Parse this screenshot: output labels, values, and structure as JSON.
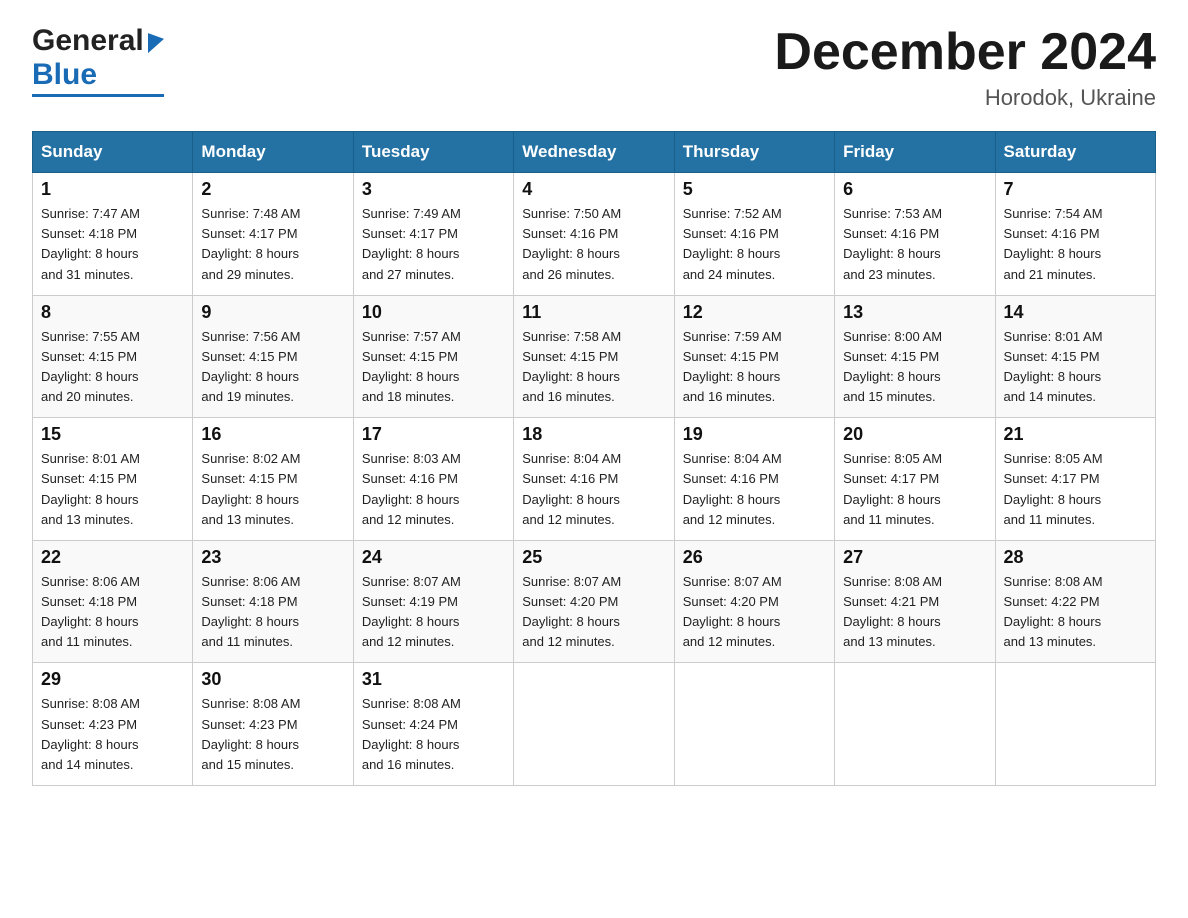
{
  "header": {
    "logo_general": "General",
    "logo_blue": "Blue",
    "month_title": "December 2024",
    "location": "Horodok, Ukraine"
  },
  "days_of_week": [
    "Sunday",
    "Monday",
    "Tuesday",
    "Wednesday",
    "Thursday",
    "Friday",
    "Saturday"
  ],
  "weeks": [
    [
      {
        "day": "1",
        "sunrise": "7:47 AM",
        "sunset": "4:18 PM",
        "daylight": "8 hours and 31 minutes."
      },
      {
        "day": "2",
        "sunrise": "7:48 AM",
        "sunset": "4:17 PM",
        "daylight": "8 hours and 29 minutes."
      },
      {
        "day": "3",
        "sunrise": "7:49 AM",
        "sunset": "4:17 PM",
        "daylight": "8 hours and 27 minutes."
      },
      {
        "day": "4",
        "sunrise": "7:50 AM",
        "sunset": "4:16 PM",
        "daylight": "8 hours and 26 minutes."
      },
      {
        "day": "5",
        "sunrise": "7:52 AM",
        "sunset": "4:16 PM",
        "daylight": "8 hours and 24 minutes."
      },
      {
        "day": "6",
        "sunrise": "7:53 AM",
        "sunset": "4:16 PM",
        "daylight": "8 hours and 23 minutes."
      },
      {
        "day": "7",
        "sunrise": "7:54 AM",
        "sunset": "4:16 PM",
        "daylight": "8 hours and 21 minutes."
      }
    ],
    [
      {
        "day": "8",
        "sunrise": "7:55 AM",
        "sunset": "4:15 PM",
        "daylight": "8 hours and 20 minutes."
      },
      {
        "day": "9",
        "sunrise": "7:56 AM",
        "sunset": "4:15 PM",
        "daylight": "8 hours and 19 minutes."
      },
      {
        "day": "10",
        "sunrise": "7:57 AM",
        "sunset": "4:15 PM",
        "daylight": "8 hours and 18 minutes."
      },
      {
        "day": "11",
        "sunrise": "7:58 AM",
        "sunset": "4:15 PM",
        "daylight": "8 hours and 16 minutes."
      },
      {
        "day": "12",
        "sunrise": "7:59 AM",
        "sunset": "4:15 PM",
        "daylight": "8 hours and 16 minutes."
      },
      {
        "day": "13",
        "sunrise": "8:00 AM",
        "sunset": "4:15 PM",
        "daylight": "8 hours and 15 minutes."
      },
      {
        "day": "14",
        "sunrise": "8:01 AM",
        "sunset": "4:15 PM",
        "daylight": "8 hours and 14 minutes."
      }
    ],
    [
      {
        "day": "15",
        "sunrise": "8:01 AM",
        "sunset": "4:15 PM",
        "daylight": "8 hours and 13 minutes."
      },
      {
        "day": "16",
        "sunrise": "8:02 AM",
        "sunset": "4:15 PM",
        "daylight": "8 hours and 13 minutes."
      },
      {
        "day": "17",
        "sunrise": "8:03 AM",
        "sunset": "4:16 PM",
        "daylight": "8 hours and 12 minutes."
      },
      {
        "day": "18",
        "sunrise": "8:04 AM",
        "sunset": "4:16 PM",
        "daylight": "8 hours and 12 minutes."
      },
      {
        "day": "19",
        "sunrise": "8:04 AM",
        "sunset": "4:16 PM",
        "daylight": "8 hours and 12 minutes."
      },
      {
        "day": "20",
        "sunrise": "8:05 AM",
        "sunset": "4:17 PM",
        "daylight": "8 hours and 11 minutes."
      },
      {
        "day": "21",
        "sunrise": "8:05 AM",
        "sunset": "4:17 PM",
        "daylight": "8 hours and 11 minutes."
      }
    ],
    [
      {
        "day": "22",
        "sunrise": "8:06 AM",
        "sunset": "4:18 PM",
        "daylight": "8 hours and 11 minutes."
      },
      {
        "day": "23",
        "sunrise": "8:06 AM",
        "sunset": "4:18 PM",
        "daylight": "8 hours and 11 minutes."
      },
      {
        "day": "24",
        "sunrise": "8:07 AM",
        "sunset": "4:19 PM",
        "daylight": "8 hours and 12 minutes."
      },
      {
        "day": "25",
        "sunrise": "8:07 AM",
        "sunset": "4:20 PM",
        "daylight": "8 hours and 12 minutes."
      },
      {
        "day": "26",
        "sunrise": "8:07 AM",
        "sunset": "4:20 PM",
        "daylight": "8 hours and 12 minutes."
      },
      {
        "day": "27",
        "sunrise": "8:08 AM",
        "sunset": "4:21 PM",
        "daylight": "8 hours and 13 minutes."
      },
      {
        "day": "28",
        "sunrise": "8:08 AM",
        "sunset": "4:22 PM",
        "daylight": "8 hours and 13 minutes."
      }
    ],
    [
      {
        "day": "29",
        "sunrise": "8:08 AM",
        "sunset": "4:23 PM",
        "daylight": "8 hours and 14 minutes."
      },
      {
        "day": "30",
        "sunrise": "8:08 AM",
        "sunset": "4:23 PM",
        "daylight": "8 hours and 15 minutes."
      },
      {
        "day": "31",
        "sunrise": "8:08 AM",
        "sunset": "4:24 PM",
        "daylight": "8 hours and 16 minutes."
      },
      null,
      null,
      null,
      null
    ]
  ],
  "labels": {
    "sunrise": "Sunrise:",
    "sunset": "Sunset:",
    "daylight": "Daylight:"
  }
}
